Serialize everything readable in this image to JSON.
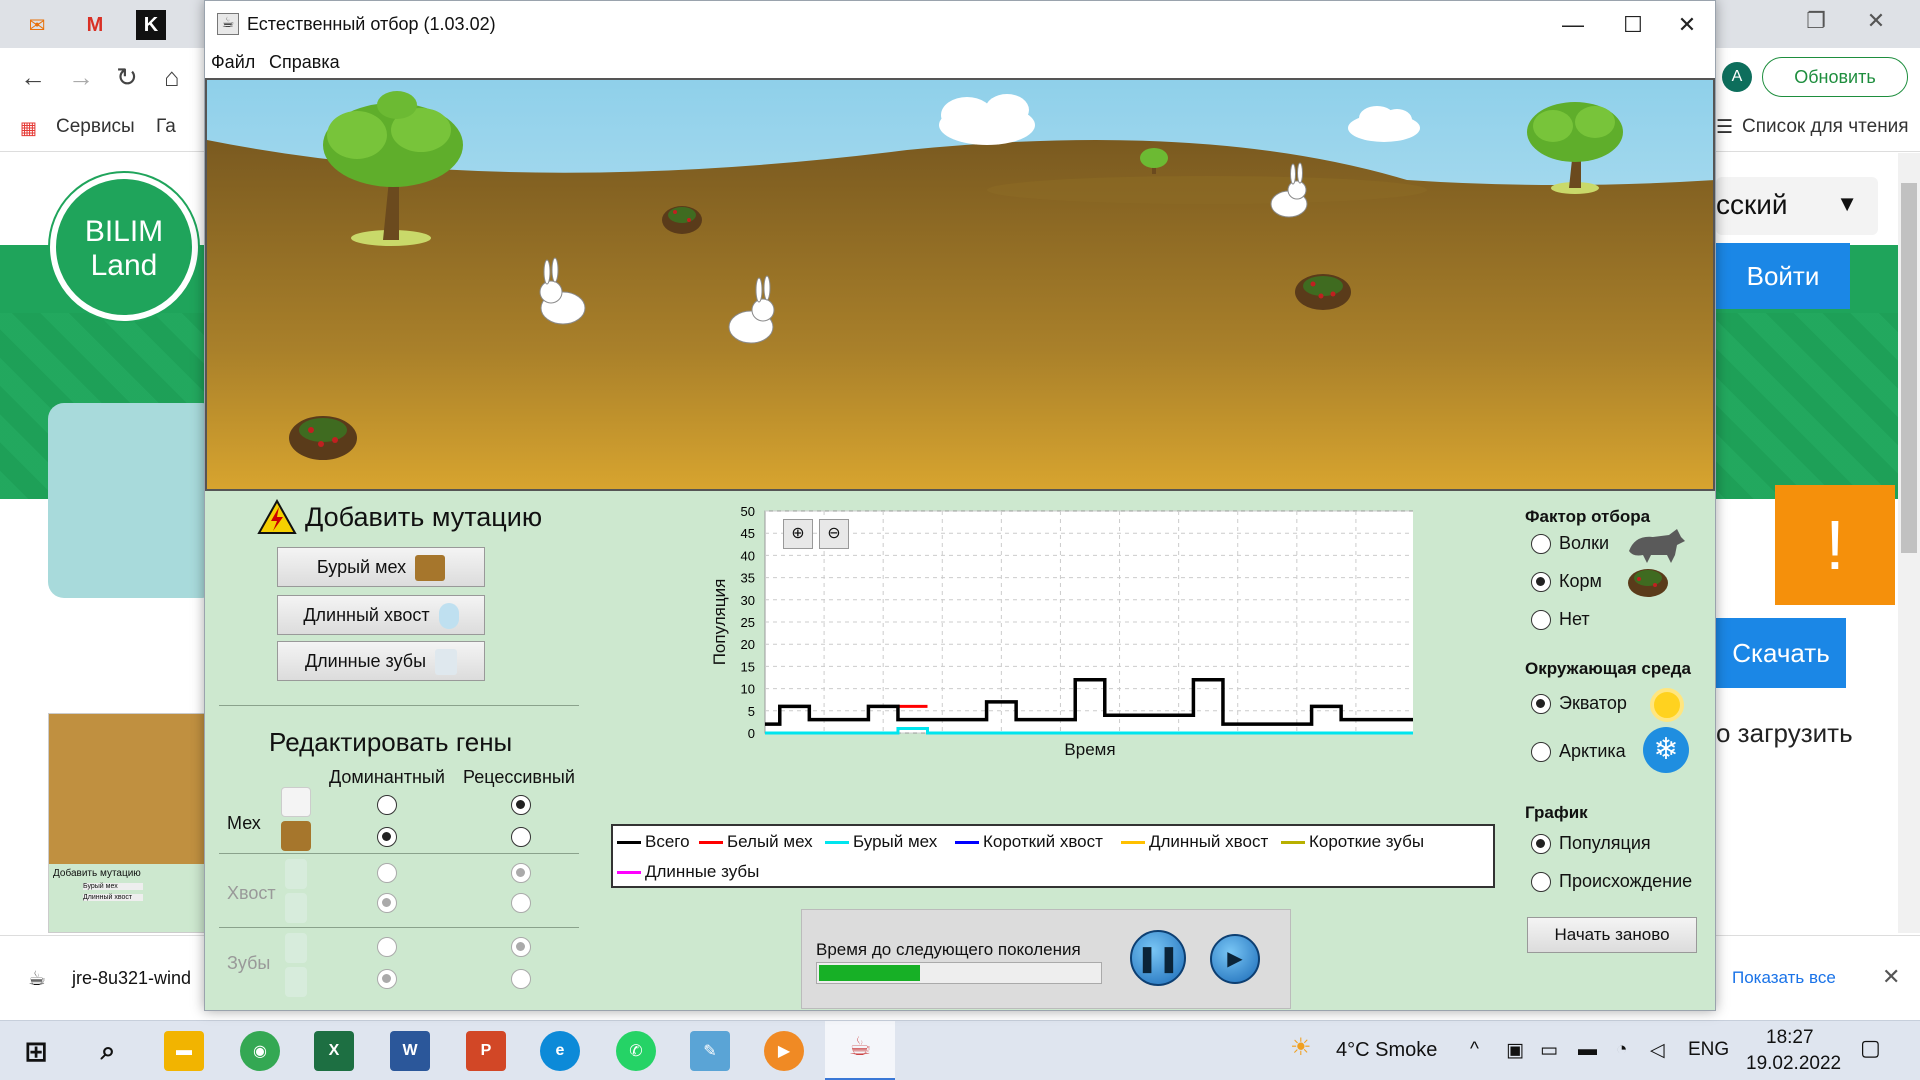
{
  "browser": {
    "bookmarks": [
      "Сервисы",
      "Га",
      "Список для чтения"
    ],
    "update_btn": "Обновить",
    "avatar": "A"
  },
  "site": {
    "logo_line1": "BILIM",
    "logo_line2": "Land",
    "lang": "сский",
    "login": "Войти",
    "download": "Скачать",
    "side_text": "о загрузить",
    "thumb_text1": "Добавить мутацию",
    "thumb_text2": "Бурый мех",
    "thumb_text3": "Длинный хвост"
  },
  "downloads": {
    "file": "jre-8u321-wind",
    "show_all": "Показать все"
  },
  "app": {
    "title": "Естественный отбор (1.03.02)",
    "menu": [
      "Файл",
      "Справка"
    ]
  },
  "mutation": {
    "title": "Добавить мутацию",
    "buttons": [
      "Бурый мех",
      "Длинный хвост",
      "Длинные зубы"
    ]
  },
  "genes": {
    "title": "Редактировать гены",
    "dominant": "Доминантный",
    "recessive": "Рецессивный",
    "rows": [
      "Мех",
      "Хвост",
      "Зубы"
    ]
  },
  "chart_data": {
    "type": "line",
    "title": "",
    "xlabel": "Время",
    "ylabel": "Популяция",
    "ylim": [
      0,
      50
    ],
    "yticks": [
      0,
      5,
      10,
      15,
      20,
      25,
      30,
      35,
      40,
      45,
      50
    ],
    "grid": true,
    "legend_placement": "below",
    "series": [
      {
        "name": "Всего",
        "color": "#000000",
        "x": [
          0,
          0.5,
          0.5,
          1.5,
          1.5,
          2.5,
          2.5,
          3.5,
          3.5,
          4.5,
          4.5,
          5.5,
          5.5,
          6.5,
          6.5,
          7.5,
          7.5,
          8.5,
          8.5,
          9.5,
          9.5,
          10.5,
          10.5,
          11.5,
          11.5,
          12.5,
          12.5,
          13.5,
          13.5,
          14.5,
          14.5,
          15.5,
          15.5,
          16.5,
          16.5,
          17.5,
          17.5,
          18.5,
          18.5,
          19.5,
          19.5,
          20.5,
          20.5,
          21.5,
          21.5,
          22
        ],
        "y": [
          2,
          2,
          6,
          6,
          3,
          3,
          3,
          3,
          6,
          6,
          3,
          3,
          3,
          3,
          3,
          3,
          7,
          7,
          3,
          3,
          3,
          3,
          12,
          12,
          4,
          4,
          4,
          4,
          4,
          4,
          12,
          12,
          2,
          2,
          2,
          2,
          2,
          2,
          6,
          6,
          3,
          3,
          3,
          3,
          3,
          3
        ]
      },
      {
        "name": "Белый мех",
        "color": "#ff0000",
        "x": [
          4.5,
          5.5
        ],
        "y": [
          6,
          6
        ]
      },
      {
        "name": "Бурый мех",
        "color": "#00e5ee",
        "x": [
          0,
          4.5,
          4.5,
          5.5,
          5.5,
          22
        ],
        "y": [
          0,
          0,
          1,
          1,
          0,
          0
        ]
      },
      {
        "name": "Короткий хвост",
        "color": "#0000ff",
        "x": [],
        "y": []
      },
      {
        "name": "Длинный хвост",
        "color": "#ffc000",
        "x": [],
        "y": []
      },
      {
        "name": "Короткие зубы",
        "color": "#b8b000",
        "x": [],
        "y": []
      },
      {
        "name": "Длинные зубы",
        "color": "#ff00ff",
        "x": [],
        "y": []
      }
    ]
  },
  "time": {
    "label": "Время до следующего поколения",
    "progress": 0.36
  },
  "selection": {
    "title": "Фактор отбора",
    "options": [
      "Волки",
      "Корм",
      "Нет"
    ],
    "selected": 1
  },
  "environment": {
    "title": "Окружающая среда",
    "options": [
      "Экватор",
      "Арктика"
    ],
    "selected": 0
  },
  "graph": {
    "title": "График",
    "options": [
      "Популяция",
      "Происхождение"
    ],
    "selected": 0
  },
  "restart": "Начать заново",
  "taskbar": {
    "weather": "4°C  Smoke",
    "lang": "ENG",
    "time": "18:27",
    "date": "19.02.2022"
  }
}
